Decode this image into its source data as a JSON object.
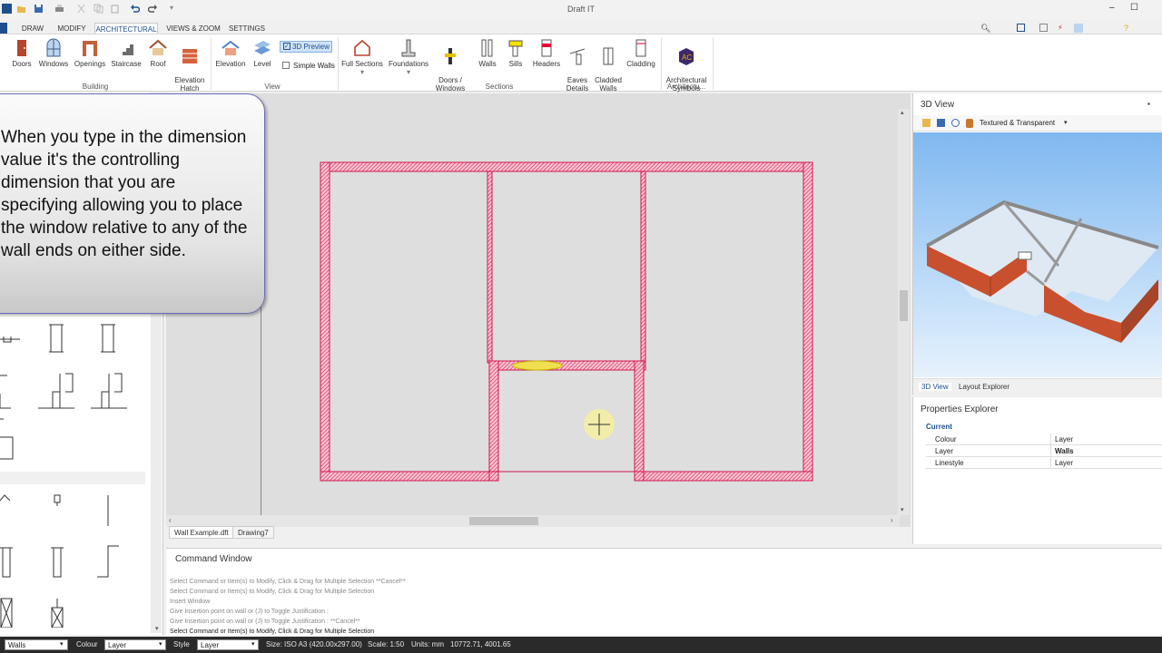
{
  "app": {
    "title": "Draft IT"
  },
  "tabs": [
    "DRAW",
    "MODIFY",
    "ARCHITECTURAL",
    "VIEWS & ZOOM",
    "SETTINGS"
  ],
  "ribbon": {
    "building": {
      "label": "Building",
      "items": [
        "Doors",
        "Windows",
        "Openings",
        "Staircase",
        "Roof",
        "Elevation\nHatch"
      ]
    },
    "view": {
      "label": "View",
      "items": [
        "Elevation",
        "Level"
      ],
      "preview3d": "3D Preview",
      "simple_walls": "Simple Walls"
    },
    "sections": {
      "label": "Sections",
      "items": [
        "Full Sections",
        "Foundations",
        "Doors /\nWindows",
        "Walls",
        "Sills",
        "Headers",
        "Eaves\nDetails",
        "Cladded\nWalls",
        "Cladding"
      ]
    },
    "architectural": {
      "label": "Architectu...",
      "item": "Architectural\nSymbols"
    }
  },
  "callout": {
    "text": "When you type in the dimension value it's the controlling dimension that you are specifying allowing you to place the window relative to any of the wall ends on either side."
  },
  "drawing_tabs": [
    "Wall Example.dft",
    "Drawing7"
  ],
  "command_window": {
    "title": "Command Window",
    "lines": [
      "Select Command or Item(s) to Modify, Click & Drag for Multiple Selection  **Cancel**",
      "Select Command or Item(s) to Modify, Click & Drag for Multiple Selection",
      "Insert Window",
      "Give Insertion point on wall or (J) to Toggle Justification :",
      "Give Insertion point on wall or (J) to Toggle Justification :  **Cancel**",
      "Select Command or Item(s) to Modify, Click & Drag for Multiple Selection"
    ]
  },
  "view3d": {
    "title": "3D View",
    "render_mode": "Textured & Transparent",
    "tabs": [
      "3D View",
      "Layout Explorer"
    ]
  },
  "properties": {
    "title": "Properties Explorer",
    "section": "Current",
    "rows": [
      {
        "name": "Colour",
        "value": "Layer"
      },
      {
        "name": "Layer",
        "value": "Walls"
      },
      {
        "name": "Linestyle",
        "value": "Layer"
      }
    ]
  },
  "status": {
    "layer": "Walls",
    "colour_label": "Colour",
    "colour_value": "Layer",
    "style_label": "Style",
    "style_value": "Layer",
    "size": "Size: ISO A3 (420.00x297.00)",
    "scale": "Scale: 1:50",
    "units": "Units: mm",
    "coords": "10772.71, 4001.65"
  },
  "colors": {
    "wall": "#e0245a",
    "accent": "#1f4e8c",
    "brick": "#c8502e"
  }
}
